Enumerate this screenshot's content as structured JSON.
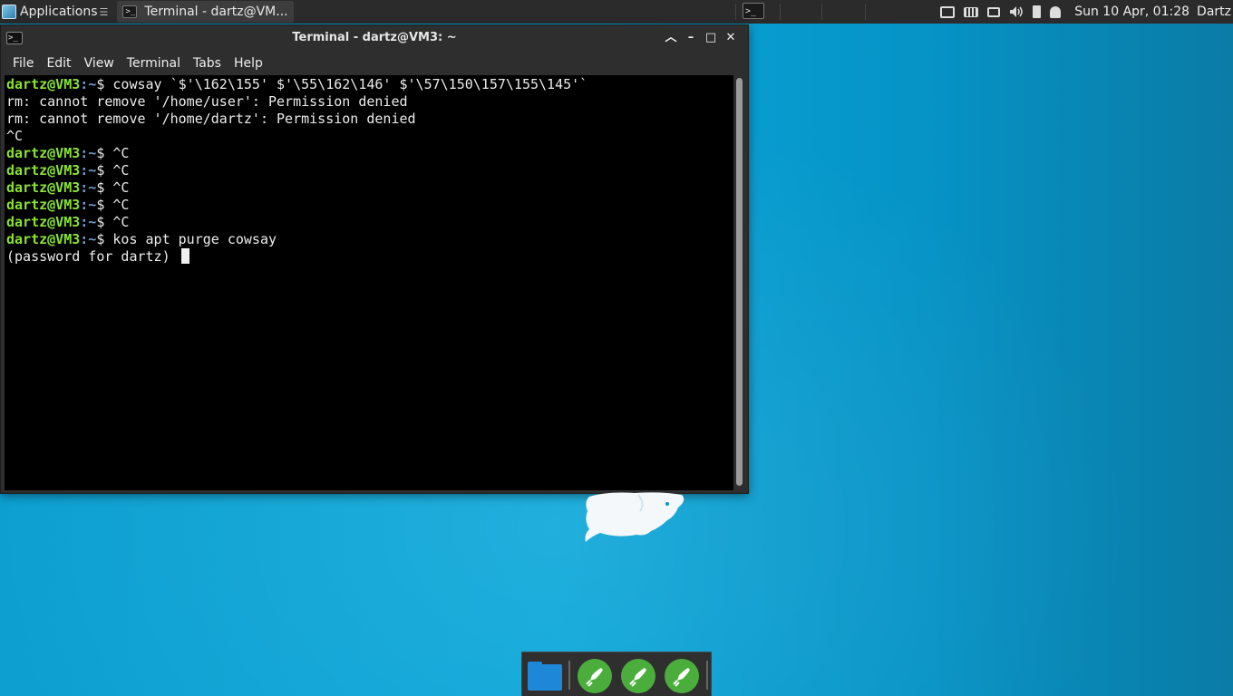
{
  "top_panel": {
    "applications_label": "Applications",
    "taskbar_window_label": "Terminal - dartz@VM...",
    "clock": "Sun 10 Apr, 01:28",
    "user": "Dartz",
    "tray_icons": [
      "network-icon",
      "keyboard-icon",
      "display-icon",
      "volume-icon",
      "battery-icon",
      "notification-bell-icon"
    ]
  },
  "terminal": {
    "title": "Terminal - dartz@VM3: ~",
    "menu": [
      "File",
      "Edit",
      "View",
      "Terminal",
      "Tabs",
      "Help"
    ],
    "prompt_user": "dartz@VM3",
    "prompt_path": ":~",
    "prompt_symbol": "$ ",
    "lines": [
      {
        "prompt": true,
        "text": "cowsay `$'\\162\\155' $'\\55\\162\\146' $'\\57\\150\\157\\155\\145'`"
      },
      {
        "prompt": false,
        "text": "rm: cannot remove '/home/user': Permission denied"
      },
      {
        "prompt": false,
        "text": "rm: cannot remove '/home/dartz': Permission denied"
      },
      {
        "prompt": false,
        "text": "^C"
      },
      {
        "prompt": true,
        "text": "^C"
      },
      {
        "prompt": true,
        "text": "^C"
      },
      {
        "prompt": true,
        "text": "^C"
      },
      {
        "prompt": true,
        "text": "^C"
      },
      {
        "prompt": true,
        "text": "^C"
      },
      {
        "prompt": true,
        "text": "kos apt purge cowsay"
      },
      {
        "prompt": false,
        "text": "(password for dartz) ",
        "cursor": true
      }
    ]
  },
  "dock": {
    "items": [
      "folder-icon",
      "rocket-launcher-icon",
      "rocket-launcher-icon",
      "rocket-launcher-icon"
    ]
  },
  "colors": {
    "desktop": "#08a6d9",
    "prompt_user": "#8ae234",
    "prompt_path": "#729fcf",
    "dock_launcher": "#4bae3c",
    "dock_folder": "#1d87d8"
  }
}
